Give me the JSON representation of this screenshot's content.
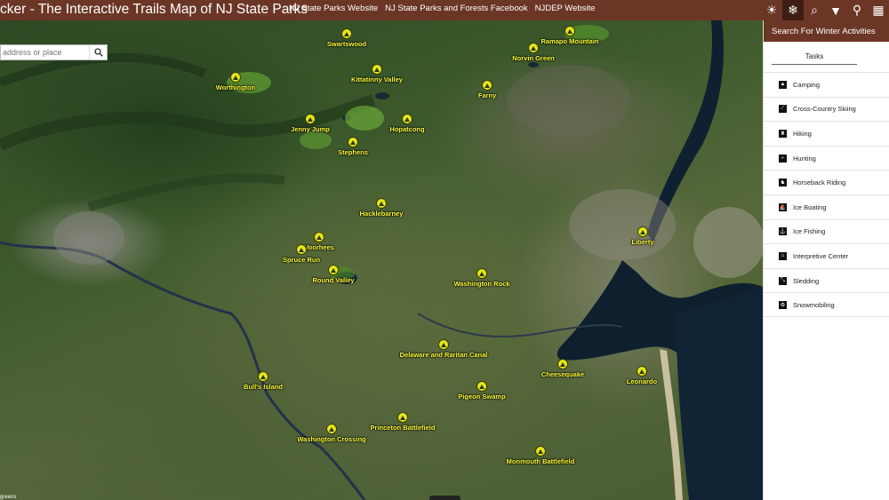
{
  "header": {
    "title": "cker - The Interactive Trails Map of NJ State Parks",
    "links": [
      "NJ State Parks Website",
      "NJ State Parks and Forests Facebook",
      "NJDEP Website"
    ],
    "tools": [
      {
        "name": "sun-icon",
        "glyph": "☀"
      },
      {
        "name": "snowflake-icon",
        "glyph": "❄"
      },
      {
        "name": "find-icon",
        "glyph": "⌕"
      },
      {
        "name": "filter-icon",
        "glyph": "▼"
      },
      {
        "name": "location-icon",
        "glyph": "⚲"
      },
      {
        "name": "grid-icon",
        "glyph": "▦"
      }
    ]
  },
  "search": {
    "placeholder": "address or place"
  },
  "parks": [
    {
      "label": "Swartswood"
    },
    {
      "label": "Ramapo Mountain"
    },
    {
      "label": "Norvin Green"
    },
    {
      "label": "Worthington"
    },
    {
      "label": "Kittatinny Valley"
    },
    {
      "label": "Farny"
    },
    {
      "label": "Jenny Jump"
    },
    {
      "label": "Hopatcong"
    },
    {
      "label": "Stephens"
    },
    {
      "label": "Hacklebarney"
    },
    {
      "label": "Liberty"
    },
    {
      "label": "Voorhees"
    },
    {
      "label": "Spruce Run"
    },
    {
      "label": "Round Valley"
    },
    {
      "label": "Washington Rock"
    },
    {
      "label": "Delaware and Raritan Canal"
    },
    {
      "label": "Cheesequake"
    },
    {
      "label": "Leonardo"
    },
    {
      "label": "Bull's Island"
    },
    {
      "label": "Pigeon Swamp"
    },
    {
      "label": "Princeton Battlefield"
    },
    {
      "label": "Washington Crossing"
    },
    {
      "label": "Monmouth Battlefield"
    }
  ],
  "attribution": "greens",
  "panel": {
    "title": "Search For Winter Activities",
    "tab": "Tasks",
    "tasks": [
      {
        "label": "Camping",
        "icon": "tent-icon",
        "glyph": "▲"
      },
      {
        "label": "Cross-Country Skiing",
        "icon": "ski-icon",
        "glyph": "⟋"
      },
      {
        "label": "Hiking",
        "icon": "hiker-icon",
        "glyph": "♜"
      },
      {
        "label": "Hunting",
        "icon": "hunting-icon",
        "glyph": "⌐"
      },
      {
        "label": "Horseback Riding",
        "icon": "horse-icon",
        "glyph": "♞"
      },
      {
        "label": "Ice Boating",
        "icon": "iceboat-icon",
        "glyph": "⛵"
      },
      {
        "label": "Ice Fishing",
        "icon": "fishing-icon",
        "glyph": "⚓"
      },
      {
        "label": "Interpretive Center",
        "icon": "center-icon",
        "glyph": "⌂"
      },
      {
        "label": "Sledding",
        "icon": "sled-icon",
        "glyph": "⤡"
      },
      {
        "label": "Snowmobiling",
        "icon": "snowmobile-icon",
        "glyph": "⚙"
      }
    ]
  }
}
